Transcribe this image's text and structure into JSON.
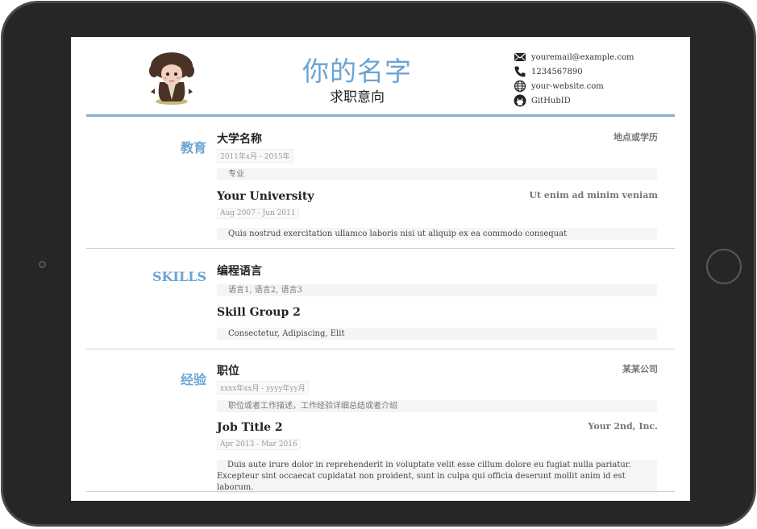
{
  "header": {
    "name": "你的名字",
    "objective": "求职意向",
    "contacts": [
      {
        "icon": "envelope-icon",
        "text": "youremail@example.com"
      },
      {
        "icon": "phone-icon",
        "text": "1234567890"
      },
      {
        "icon": "globe-icon",
        "text": "your-website.com"
      },
      {
        "icon": "github-icon",
        "text": "GitHubID"
      }
    ]
  },
  "sections": {
    "education": {
      "title": "教育",
      "entries": [
        {
          "title": "大学名称",
          "right": "地点或学历",
          "date": "2011年x月 - 2015年",
          "desc": "专业"
        },
        {
          "title": "Your University",
          "right": "Ut enim ad minim veniam",
          "date": "Aug 2007 - Jun 2011",
          "desc": "Quis nostrud exercitation ullamco laboris nisi ut aliquip ex ea commodo consequat"
        }
      ]
    },
    "skills": {
      "title": "SKILLS",
      "entries": [
        {
          "title": "编程语言",
          "desc": "语言1, 语言2, 语言3"
        },
        {
          "title": "Skill Group 2",
          "desc": "Consectetur, Adipiscing, Elit"
        }
      ]
    },
    "experience": {
      "title": "经验",
      "entries": [
        {
          "title": "职位",
          "right": "某某公司",
          "date": "xxxx年xx月 - yyyy年yy月",
          "desc": "职位或者工作描述，工作经验详细总结或者介绍"
        },
        {
          "title": "Job Title 2",
          "right": "Your 2nd, Inc.",
          "date": "Apr 2013 - Mar 2016",
          "desc": "Duis aute irure dolor in reprehenderit in voluptate velit esse cillum dolore eu fugiat nulla pariatur. Excepteur sint occaecat cupidatat non proident, sunt in culpa qui officia deserunt mollit anim id est laborum."
        }
      ]
    }
  },
  "colors": {
    "accent": "#6ba4d4",
    "rule": "#7fb1d9",
    "device_frame": "#262626"
  }
}
